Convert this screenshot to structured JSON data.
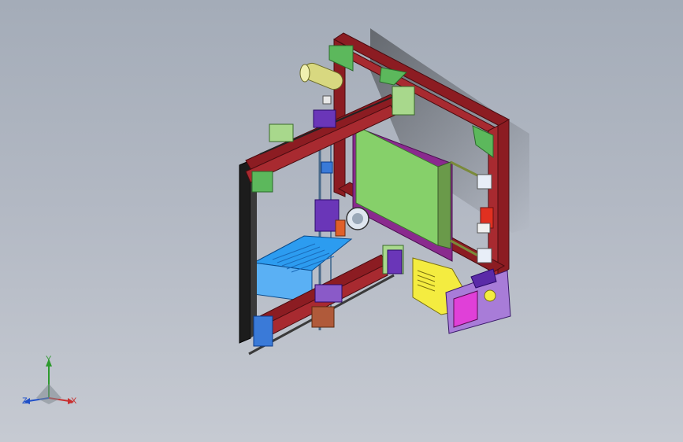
{
  "viewport": {
    "background_top": "#a4acb8",
    "background_bottom": "#c6cad2"
  },
  "colors": {
    "frame_red": "#8c1c22",
    "print_bed": "#86d06a",
    "bed_plate": "#8a2a8e",
    "power_supply": "#2c9cf0",
    "lcd_screen": "#e040d8",
    "lcd_case": "#a87cd8",
    "control_box": "#f4ec40",
    "bracket_green": "#5cb85c",
    "motor_green": "#a8d88c",
    "carriage_purple": "#6a36b8",
    "filament_spool": "#d8d880",
    "pulley_blue": "#3a7ad8",
    "endstop_red": "#e03020",
    "idler_brown": "#b05a3a"
  },
  "triad": {
    "y_label": "Y",
    "z_label": "Z",
    "x_label": "X",
    "y_color": "#2e9a2e",
    "z_color": "#2050c8",
    "x_color": "#c83030"
  }
}
